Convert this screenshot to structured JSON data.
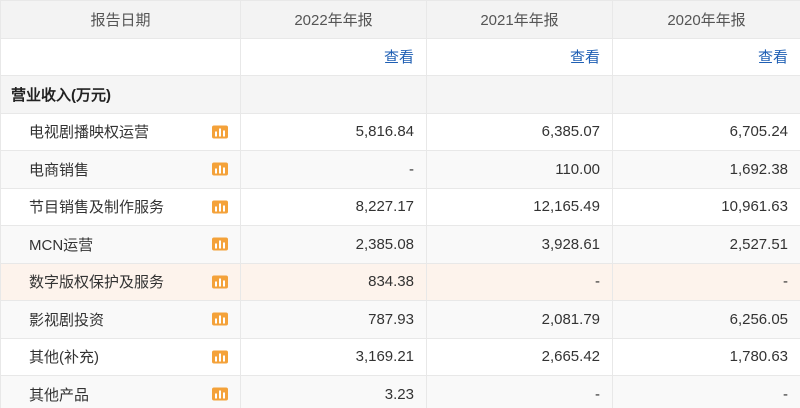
{
  "header": {
    "col_label": "报告日期",
    "periods": [
      "2022年年报",
      "2021年年报",
      "2020年年报"
    ]
  },
  "view_link": "查看",
  "section_title": "营业收入(万元)",
  "icon": "bar-chart-icon",
  "rows": [
    {
      "name": "电视剧播映权运营",
      "values": [
        "5,816.84",
        "6,385.07",
        "6,705.24"
      ]
    },
    {
      "name": "电商销售",
      "values": [
        "-",
        "110.00",
        "1,692.38"
      ]
    },
    {
      "name": "节目销售及制作服务",
      "values": [
        "8,227.17",
        "12,165.49",
        "10,961.63"
      ]
    },
    {
      "name": "MCN运营",
      "values": [
        "2,385.08",
        "3,928.61",
        "2,527.51"
      ]
    },
    {
      "name": "数字版权保护及服务",
      "values": [
        "834.38",
        "-",
        "-"
      ]
    },
    {
      "name": "影视剧投资",
      "values": [
        "787.93",
        "2,081.79",
        "6,256.05"
      ]
    },
    {
      "name": "其他(补充)",
      "values": [
        "3,169.21",
        "2,665.42",
        "1,780.63"
      ]
    },
    {
      "name": "其他产品",
      "values": [
        "3.23",
        "-",
        "-"
      ]
    }
  ]
}
